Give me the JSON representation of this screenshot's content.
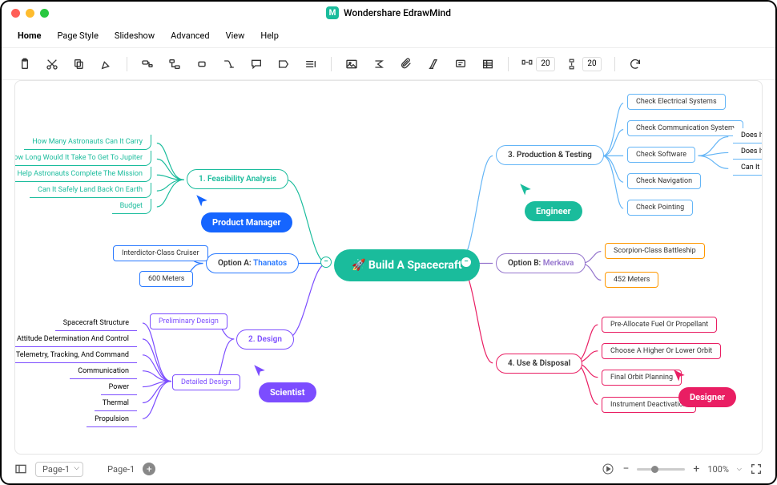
{
  "app": {
    "title": "Wondershare EdrawMind"
  },
  "menu": {
    "home": "Home",
    "pageStyle": "Page Style",
    "slideshow": "Slideshow",
    "advanced": "Advanced",
    "view": "View",
    "help": "Help"
  },
  "toolbar": {
    "hspacing": "20",
    "vspacing": "20"
  },
  "status": {
    "pageSelector": "Page-1",
    "pageTab": "Page-1",
    "zoom": "100%"
  },
  "mindmap": {
    "root": "Build A Spacecraft",
    "rootIcon": "🚀",
    "feasibility": {
      "title": "1. Feasibility Analysis",
      "callout": "Product Manager",
      "items": [
        "How Many Astronauts Can It Carry",
        "How Long Would It Take To Get To Jupiter",
        "How To Help Astronauts Complete The Mission",
        "Can It Safely Land Back On Earth",
        "Budget"
      ]
    },
    "optionA": {
      "title": "Option A:",
      "highlight": "Thanatos",
      "items": [
        "Interdictor-Class Cruiser",
        "600 Meters"
      ]
    },
    "design": {
      "title": "2. Design",
      "callout": "Scientist",
      "items": [
        "Preliminary Design",
        "Detailed Design"
      ],
      "detailed": [
        "Spacecraft Structure",
        "Attitude Determination And Control",
        "Telemetry, Tracking, And Command",
        "Communication",
        "Power",
        "Thermal",
        "Propulsion"
      ]
    },
    "production": {
      "title": "3. Production & Testing",
      "callout": "Engineer",
      "items": [
        "Check Electrical Systems",
        "Check Communication System",
        "Check Software",
        "Check Navigation",
        "Check Pointing"
      ],
      "software": [
        "Does It Cover All",
        "Does It Cover All",
        "Can It Process In"
      ]
    },
    "optionB": {
      "title": "Option B:",
      "highlight": "Merkava",
      "items": [
        "Scorpion-Class Battleship",
        "452 Meters"
      ]
    },
    "useDisposal": {
      "title": "4. Use & Disposal",
      "callout": "Designer",
      "items": [
        "Pre-Allocate Fuel Or Propellant",
        "Choose A Higher Or Lower Orbit",
        "Final Orbit Planning",
        "Instrument Deactivation"
      ]
    }
  }
}
